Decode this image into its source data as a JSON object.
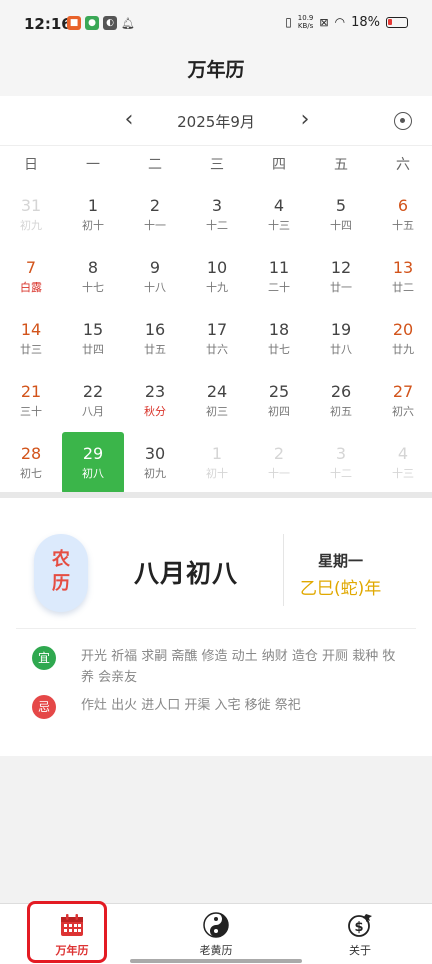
{
  "status_bar": {
    "time": "12:16",
    "net_speed_value": "10.9",
    "net_speed_unit": "KB/s",
    "battery": "18%"
  },
  "header": {
    "title": "万年历"
  },
  "calendar": {
    "month_label": "2025年9月",
    "prev_symbol": "‹",
    "next_symbol": "›",
    "weekdays": [
      "日",
      "一",
      "二",
      "三",
      "四",
      "五",
      "六"
    ],
    "days": [
      {
        "num": "31",
        "lunar": "初九",
        "type": "faded"
      },
      {
        "num": "1",
        "lunar": "初十",
        "type": ""
      },
      {
        "num": "2",
        "lunar": "十一",
        "type": ""
      },
      {
        "num": "3",
        "lunar": "十二",
        "type": ""
      },
      {
        "num": "4",
        "lunar": "十三",
        "type": ""
      },
      {
        "num": "5",
        "lunar": "十四",
        "type": ""
      },
      {
        "num": "6",
        "lunar": "十五",
        "type": "weekend"
      },
      {
        "num": "7",
        "lunar": "白露",
        "type": "weekend festival"
      },
      {
        "num": "8",
        "lunar": "十七",
        "type": ""
      },
      {
        "num": "9",
        "lunar": "十八",
        "type": ""
      },
      {
        "num": "10",
        "lunar": "十九",
        "type": ""
      },
      {
        "num": "11",
        "lunar": "二十",
        "type": ""
      },
      {
        "num": "12",
        "lunar": "廿一",
        "type": ""
      },
      {
        "num": "13",
        "lunar": "廿二",
        "type": "weekend"
      },
      {
        "num": "14",
        "lunar": "廿三",
        "type": "weekend"
      },
      {
        "num": "15",
        "lunar": "廿四",
        "type": ""
      },
      {
        "num": "16",
        "lunar": "廿五",
        "type": ""
      },
      {
        "num": "17",
        "lunar": "廿六",
        "type": ""
      },
      {
        "num": "18",
        "lunar": "廿七",
        "type": ""
      },
      {
        "num": "19",
        "lunar": "廿八",
        "type": ""
      },
      {
        "num": "20",
        "lunar": "廿九",
        "type": "weekend"
      },
      {
        "num": "21",
        "lunar": "三十",
        "type": "weekend"
      },
      {
        "num": "22",
        "lunar": "八月",
        "type": ""
      },
      {
        "num": "23",
        "lunar": "秋分",
        "type": "festival"
      },
      {
        "num": "24",
        "lunar": "初三",
        "type": ""
      },
      {
        "num": "25",
        "lunar": "初四",
        "type": ""
      },
      {
        "num": "26",
        "lunar": "初五",
        "type": ""
      },
      {
        "num": "27",
        "lunar": "初六",
        "type": "weekend"
      },
      {
        "num": "28",
        "lunar": "初七",
        "type": "weekend"
      },
      {
        "num": "29",
        "lunar": "初八",
        "type": "selected"
      },
      {
        "num": "30",
        "lunar": "初九",
        "type": ""
      },
      {
        "num": "1",
        "lunar": "初十",
        "type": "faded"
      },
      {
        "num": "2",
        "lunar": "十一",
        "type": "faded"
      },
      {
        "num": "3",
        "lunar": "十二",
        "type": "faded"
      },
      {
        "num": "4",
        "lunar": "十三",
        "type": "faded"
      }
    ]
  },
  "info": {
    "badge_line1": "农",
    "badge_line2": "历",
    "lunar_date": "八月初八",
    "weekday": "星期一",
    "ganzhi_year": "乙巳(蛇)年",
    "yi_label": "宜",
    "yi_text": "开光 祈福 求嗣 斋醮 修造 动土 纳财 造仓 开厕 栽种 牧养 会亲友",
    "ji_label": "忌",
    "ji_text": "作灶 出火 进人口 开渠 入宅 移徙 祭祀"
  },
  "tabs": [
    {
      "label": "万年历",
      "icon": "calendar-icon"
    },
    {
      "label": "老黄历",
      "icon": "yin-yang-icon"
    },
    {
      "label": "关于",
      "icon": "dollar-plane-icon"
    }
  ],
  "colors": {
    "selected_green": "#3bb54a",
    "weekend_orange": "#d2541b",
    "festival_red": "#d9342b",
    "ganzhi_gold": "#e0a800",
    "active_tab_red": "#d33"
  }
}
